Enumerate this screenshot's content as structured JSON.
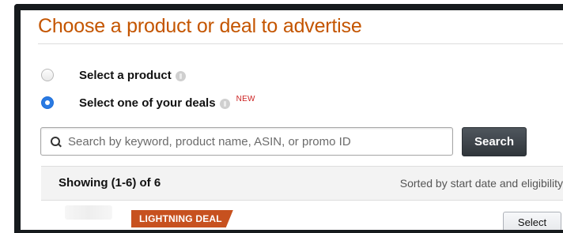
{
  "title": "Choose a product or deal to advertise",
  "options": [
    {
      "label": "Select a product",
      "checked": false,
      "new": ""
    },
    {
      "label": "Select one of your deals",
      "checked": true,
      "new": "NEW"
    }
  ],
  "search": {
    "placeholder": "Search by keyword, product name, ASIN, or promo ID",
    "button_label": "Search"
  },
  "results": {
    "showing": "Showing (1-6) of 6",
    "sorted": "Sorted by start date and eligibility"
  },
  "row": {
    "badge": "LIGHTNING DEAL",
    "select_label": "Select"
  },
  "colors": {
    "title": "#c45500",
    "deal_badge": "#c7511f",
    "radio_selected": "#2a7ae2",
    "new_tag": "#cc1f1f"
  }
}
